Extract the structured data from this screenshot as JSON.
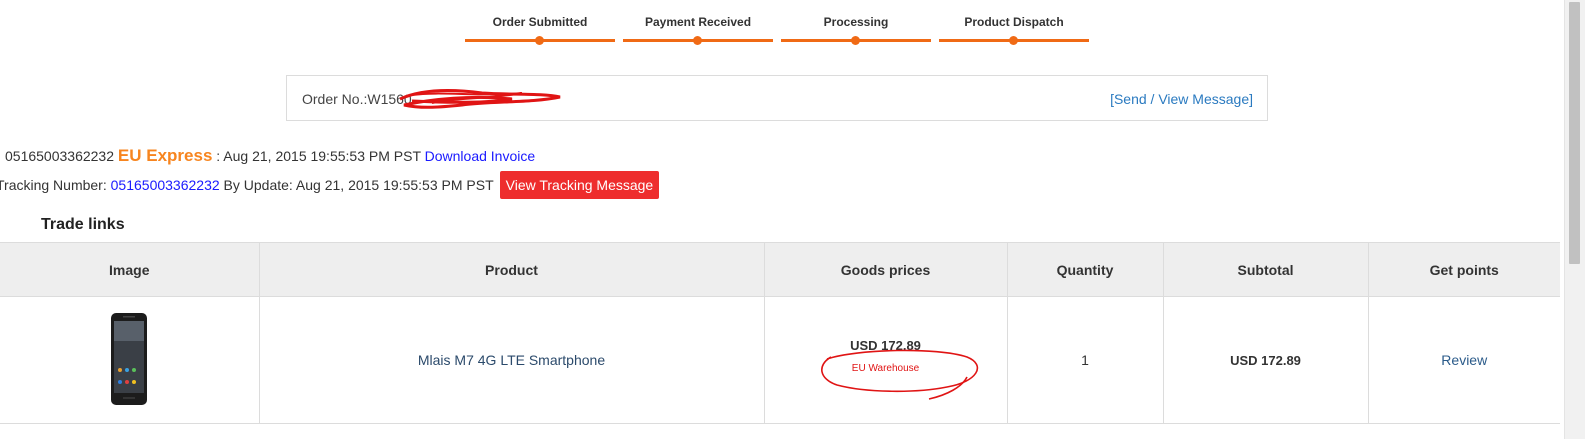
{
  "progress": {
    "steps": [
      {
        "label": "Order Submitted"
      },
      {
        "label": "Payment Received"
      },
      {
        "label": "Processing"
      },
      {
        "label": "Product Dispatch"
      }
    ]
  },
  "order": {
    "number_label": "Order No.:W1560",
    "send_view_message": "[Send / View Message]"
  },
  "shipping": {
    "tracking_id": "05165003362232",
    "carrier": "EU Express",
    "date_text": ": Aug 21, 2015 19:55:53 PM PST",
    "download_invoice": "Download Invoice",
    "tracking_label": "Tracking Number:",
    "tracking_number": "05165003362232",
    "update_text": "By Update: Aug 21, 2015 19:55:53 PM PST",
    "view_tracking_button": "View Tracking Message"
  },
  "trade_links": {
    "title": "Trade links",
    "columns": [
      "Image",
      "Product",
      "Goods prices",
      "Quantity",
      "Subtotal",
      "Get points"
    ],
    "rows": [
      {
        "product": "Mlais M7 4G LTE Smartphone",
        "price": "USD 172.89",
        "warehouse": "EU Warehouse",
        "quantity": "1",
        "subtotal": "USD 172.89",
        "points": "Review"
      }
    ]
  },
  "colors": {
    "accent_orange": "#f06a15",
    "carrier_orange": "#f7851f",
    "button_red": "#ee2d2d",
    "link_blue": "#2a7ac0",
    "annotation_red": "#e01414"
  }
}
